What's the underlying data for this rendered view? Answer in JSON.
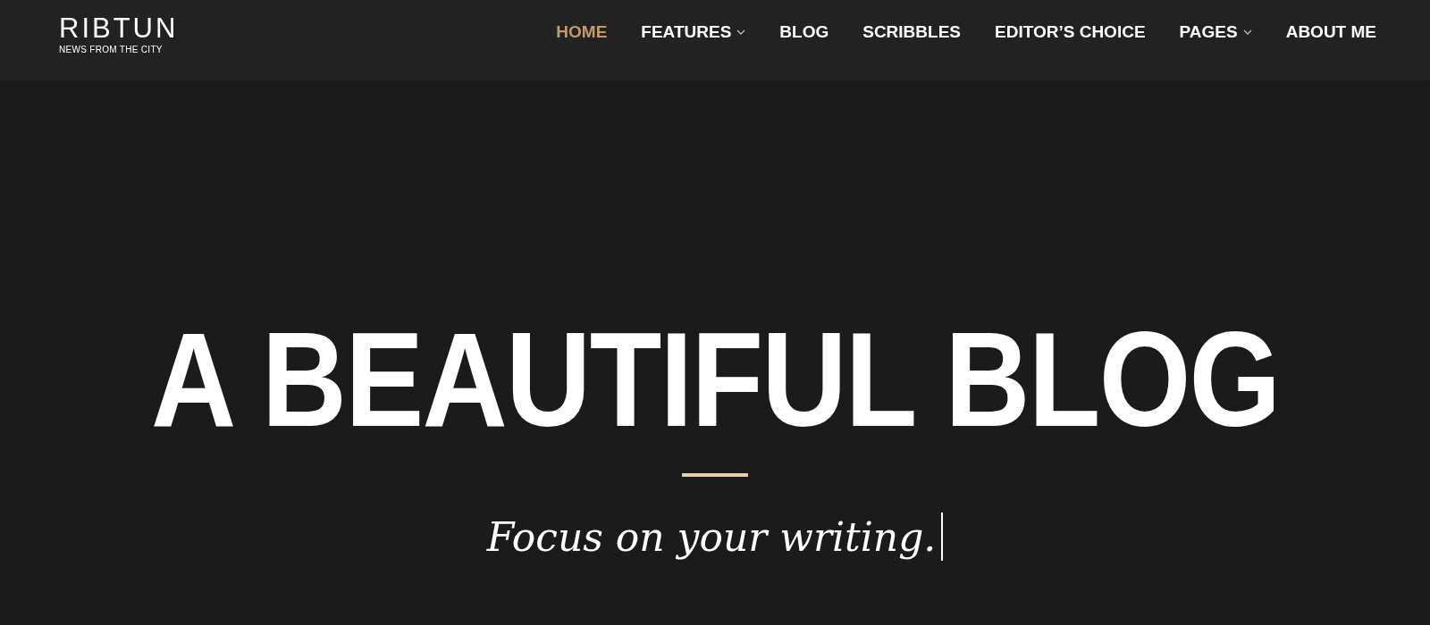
{
  "logo": {
    "title": "RIBTUN",
    "tagline": "NEWS FROM THE CITY"
  },
  "nav": [
    {
      "label": "HOME",
      "selected": true,
      "has_dropdown": false
    },
    {
      "label": "FEATURES",
      "selected": false,
      "has_dropdown": true
    },
    {
      "label": "BLOG",
      "selected": false,
      "has_dropdown": false
    },
    {
      "label": "SCRIBBLES",
      "selected": false,
      "has_dropdown": false
    },
    {
      "label": "EDITOR’S CHOICE",
      "selected": false,
      "has_dropdown": false
    },
    {
      "label": "PAGES",
      "selected": false,
      "has_dropdown": true
    },
    {
      "label": "ABOUT ME",
      "selected": false,
      "has_dropdown": false
    }
  ],
  "hero": {
    "headline": "A BEAUTIFUL BLOG",
    "subtitle": "Focus on your writing."
  }
}
